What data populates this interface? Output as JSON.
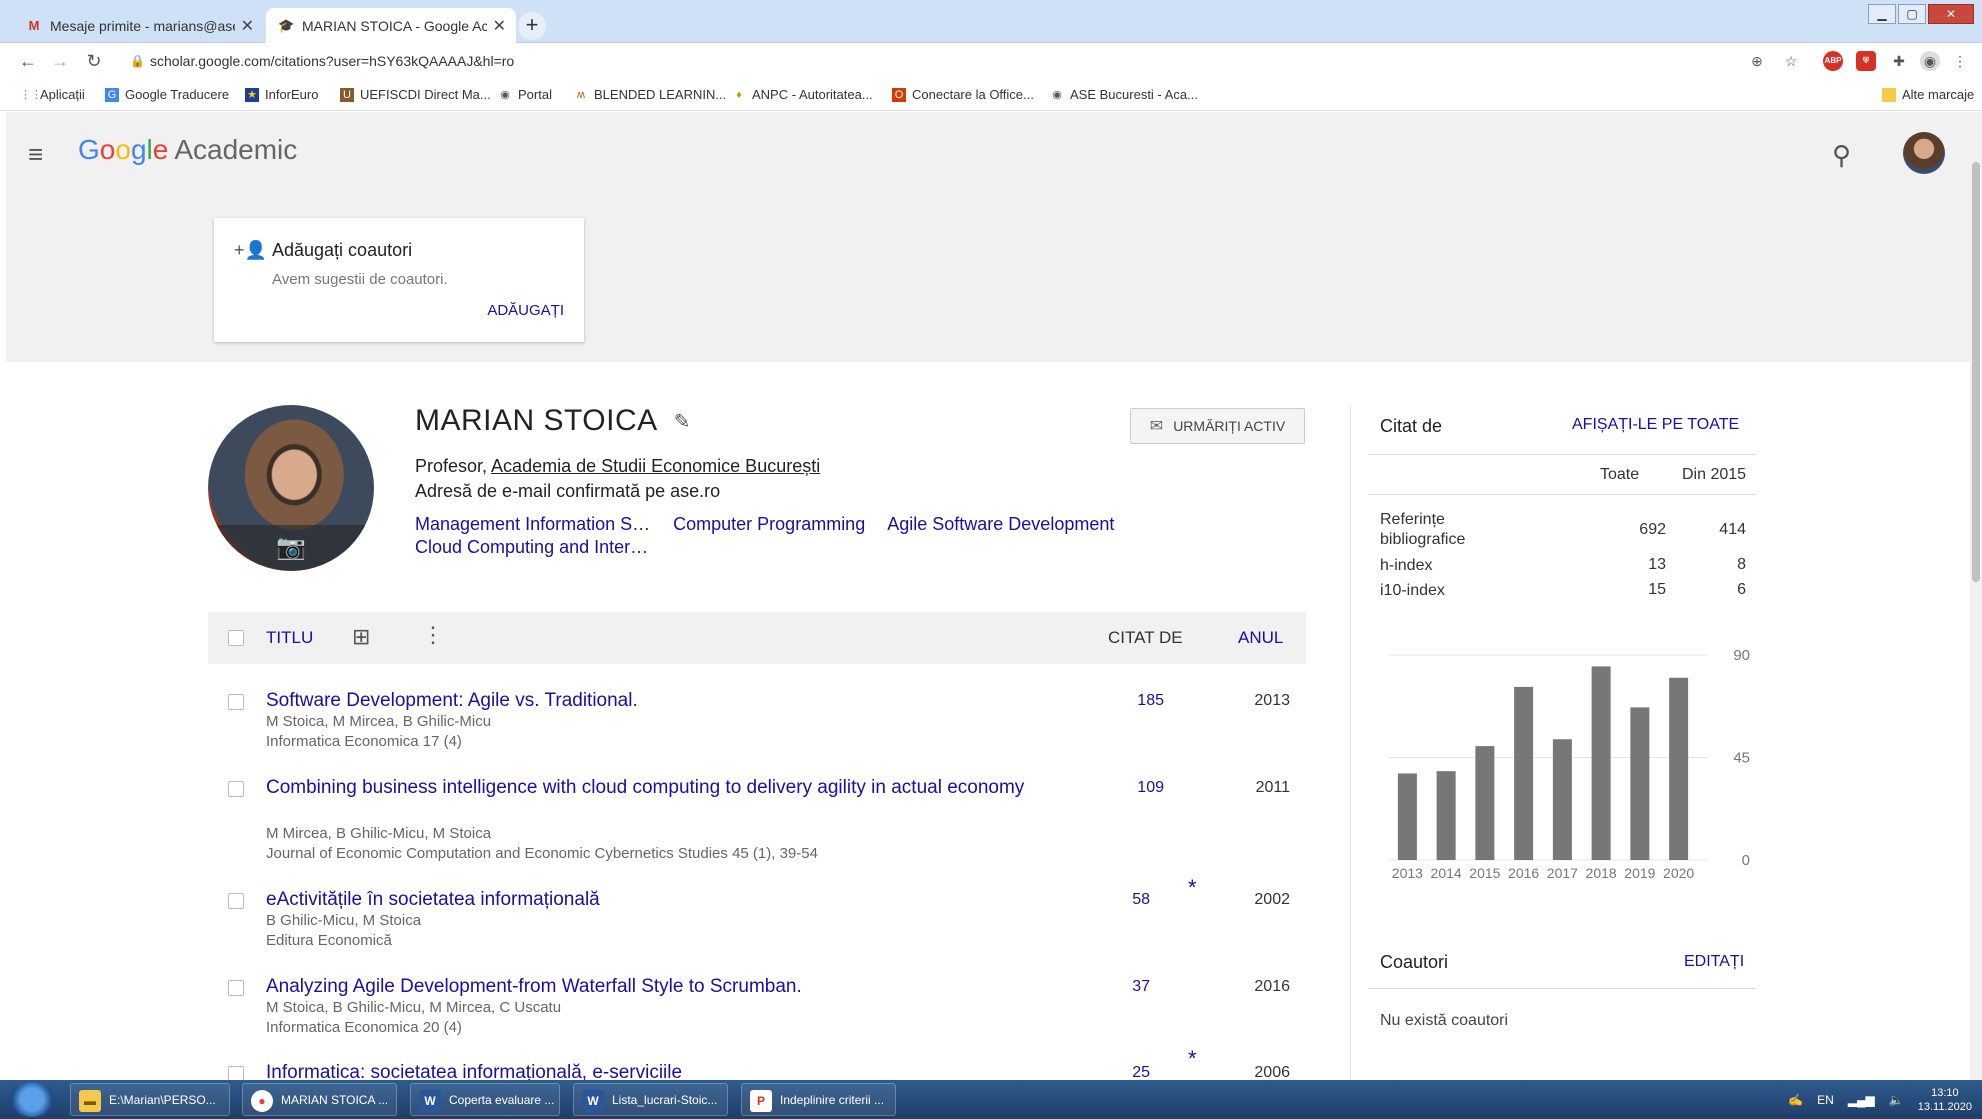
{
  "browser": {
    "tabs": [
      {
        "title": "Mesaje primite - marians@ase.ro",
        "favicon": "M"
      },
      {
        "title": "MARIAN STOICA - Google Academic",
        "favicon": "🎓"
      }
    ],
    "new_tab": "+",
    "url": "scholar.google.com/citations?user=hSY63kQAAAAJ&hl=ro",
    "bookmarks": [
      {
        "label": "Aplicații",
        "icon": "apps-icon"
      },
      {
        "label": "Google Traducere",
        "icon": "translate-icon"
      },
      {
        "label": "InforEuro",
        "icon": "eu-flag-icon"
      },
      {
        "label": "UEFISCDI Direct Ma...",
        "icon": "uefiscdi-icon"
      },
      {
        "label": "Portal",
        "icon": "globe-icon"
      },
      {
        "label": "BLENDED LEARNIN...",
        "icon": "bl-icon"
      },
      {
        "label": "ANPC - Autoritatea...",
        "icon": "anpc-icon"
      },
      {
        "label": "Conectare la Office...",
        "icon": "office-icon"
      },
      {
        "label": "ASE Bucuresti - Aca...",
        "icon": "globe-icon"
      }
    ],
    "other_bookmarks": "Alte marcaje"
  },
  "scholar": {
    "logo_google": "Google",
    "logo_suffix": "Academic",
    "coauthor_card": {
      "title": "Adăugați coautori",
      "subtitle": "Avem sugestii de coautori.",
      "action": "ADĂUGAȚI"
    },
    "profile": {
      "name": "MARIAN STOICA",
      "affiliation_prefix": "Profesor, ",
      "affiliation": "Academia de Studii Economice București",
      "email": "Adresă de e-mail confirmată pe ase.ro",
      "topics": [
        "Management Information S…",
        "Computer Programming",
        "Agile Software Development",
        "Cloud Computing and Inter…"
      ],
      "follow": "URMĂRIȚI ACTIV"
    },
    "table": {
      "col_title": "TITLU",
      "col_cited": "CITAT DE",
      "col_year": "ANUL",
      "articles": [
        {
          "title": "Software Development: Agile vs. Traditional.",
          "authors": "M Stoica, M Mircea, B Ghilic-Micu",
          "venue": "Informatica Economica 17 (4)",
          "cites": "185",
          "star": "",
          "year": "2013"
        },
        {
          "title": "Combining business intelligence with cloud computing to delivery agility in actual economy",
          "authors": "M Mircea, B Ghilic-Micu, M Stoica",
          "venue": "Journal of Economic Computation and Economic Cybernetics Studies 45 (1), 39-54",
          "cites": "109",
          "star": "",
          "year": "2011"
        },
        {
          "title": "eActivitățile în societatea informațională",
          "authors": "B Ghilic-Micu, M Stoica",
          "venue": "Editura Economică",
          "cites": "58",
          "star": "*",
          "year": "2002"
        },
        {
          "title": "Analyzing Agile Development-from Waterfall Style to Scrumban.",
          "authors": "M Stoica, B Ghilic-Micu, M Mircea, C Uscatu",
          "venue": "Informatica Economica 20 (4)",
          "cites": "37",
          "star": "",
          "year": "2016"
        },
        {
          "title": "Informatica: societatea informațională, e-serviciile",
          "authors": "",
          "venue": "",
          "cites": "25",
          "star": "*",
          "year": "2006"
        }
      ]
    },
    "cited_by": {
      "title": "Citat de",
      "show_all": "AFIȘAȚI-LE PE TOATE",
      "col_all": "Toate",
      "col_since": "Din 2015",
      "rows": [
        {
          "label": "Referințe bibliografice",
          "all": "692",
          "since": "414"
        },
        {
          "label": "h-index",
          "all": "13",
          "since": "8"
        },
        {
          "label": "i10-index",
          "all": "15",
          "since": "6"
        }
      ]
    },
    "coauthors": {
      "title": "Coautori",
      "edit": "EDITAȚI",
      "empty": "Nu există coautori"
    }
  },
  "chart_data": {
    "type": "bar",
    "categories": [
      "2013",
      "2014",
      "2015",
      "2016",
      "2017",
      "2018",
      "2019",
      "2020"
    ],
    "values": [
      38,
      39,
      50,
      76,
      53,
      85,
      67,
      80
    ],
    "yticks": [
      "90",
      "45",
      "0"
    ],
    "ylim": [
      0,
      90
    ],
    "bar_color": "#777777"
  },
  "taskbar": {
    "items": [
      {
        "label": "E:\\Marian\\PERSO...",
        "icon": "folder-icon"
      },
      {
        "label": "MARIAN STOICA ...",
        "icon": "chrome-icon"
      },
      {
        "label": "Coperta evaluare ...",
        "icon": "word-icon"
      },
      {
        "label": "Lista_lucrari-Stoic...",
        "icon": "word-icon"
      },
      {
        "label": "Indeplinire criterii ...",
        "icon": "pdf-icon"
      }
    ],
    "lang": "EN",
    "time": "13:10",
    "date": "13.11.2020"
  }
}
